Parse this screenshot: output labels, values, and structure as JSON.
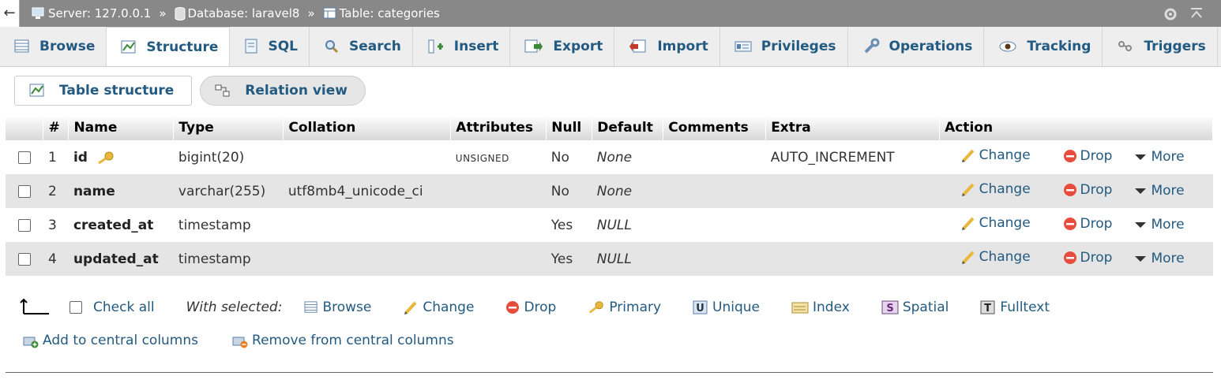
{
  "breadcrumb": {
    "server": "Server: 127.0.0.1",
    "database": "Database: laravel8",
    "table": "Table: categories",
    "separator": "»"
  },
  "tabs": [
    {
      "label": "Browse",
      "icon": "browse-icon"
    },
    {
      "label": "Structure",
      "icon": "structure-icon",
      "active": true
    },
    {
      "label": "SQL",
      "icon": "sql-icon"
    },
    {
      "label": "Search",
      "icon": "search-icon"
    },
    {
      "label": "Insert",
      "icon": "insert-icon"
    },
    {
      "label": "Export",
      "icon": "export-icon"
    },
    {
      "label": "Import",
      "icon": "import-icon"
    },
    {
      "label": "Privileges",
      "icon": "privileges-icon"
    },
    {
      "label": "Operations",
      "icon": "wrench-icon"
    },
    {
      "label": "Tracking",
      "icon": "eye-icon"
    },
    {
      "label": "Triggers",
      "icon": "triggers-icon"
    }
  ],
  "subtabs": {
    "table_structure": "Table structure",
    "relation_view": "Relation view"
  },
  "table": {
    "headers": [
      "#",
      "Name",
      "Type",
      "Collation",
      "Attributes",
      "Null",
      "Default",
      "Comments",
      "Extra",
      "Action"
    ],
    "rows": [
      {
        "num": "1",
        "name": "id",
        "type": "bigint(20)",
        "collation": "",
        "attributes": "UNSIGNED",
        "null": "No",
        "default": "None",
        "comments": "",
        "extra": "AUTO_INCREMENT",
        "primary_key": true
      },
      {
        "num": "2",
        "name": "name",
        "type": "varchar(255)",
        "collation": "utf8mb4_unicode_ci",
        "attributes": "",
        "null": "No",
        "default": "None",
        "comments": "",
        "extra": ""
      },
      {
        "num": "3",
        "name": "created_at",
        "type": "timestamp",
        "collation": "",
        "attributes": "",
        "null": "Yes",
        "default": "NULL",
        "comments": "",
        "extra": ""
      },
      {
        "num": "4",
        "name": "updated_at",
        "type": "timestamp",
        "collation": "",
        "attributes": "",
        "null": "Yes",
        "default": "NULL",
        "comments": "",
        "extra": ""
      }
    ],
    "actions": {
      "change": "Change",
      "drop": "Drop",
      "more": "More"
    }
  },
  "bulk": {
    "check_all": "Check all",
    "with_selected": "With selected:",
    "browse": "Browse",
    "change": "Change",
    "drop": "Drop",
    "primary": "Primary",
    "unique": "Unique",
    "index": "Index",
    "spatial": "Spatial",
    "fulltext": "Fulltext"
  },
  "central": {
    "add": "Add to central columns",
    "remove": "Remove from central columns"
  },
  "colors": {
    "link": "#235a81",
    "titlebar": "#888888",
    "row_alt": "#e5e5e5"
  }
}
